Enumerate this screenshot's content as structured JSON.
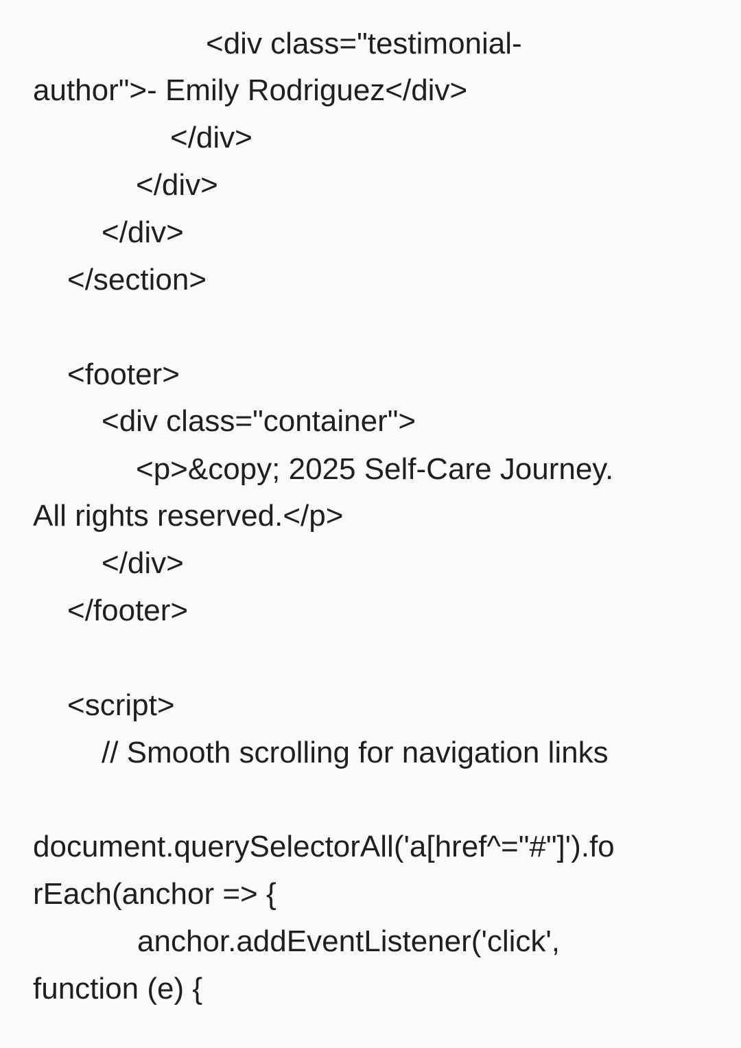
{
  "code_lines": [
    "                <div class=\"testimonial-",
    "author\">- Emily Rodriguez</div>",
    "            </div>",
    "        </div>",
    "    </div>",
    "</section>",
    "",
    "<footer>",
    "    <div class=\"container\">",
    "        <p>&copy; 2025 Self-Care Journey.",
    "All rights reserved.</p>",
    "    </div>",
    "</footer>",
    "",
    "<script>",
    "    // Smooth scrolling for navigation links",
    "",
    "document.querySelectorAll('a[href^=\"#\"]').fo",
    "rEach(anchor => {",
    "        anchor.addEventListener('click',",
    "function (e) {"
  ]
}
